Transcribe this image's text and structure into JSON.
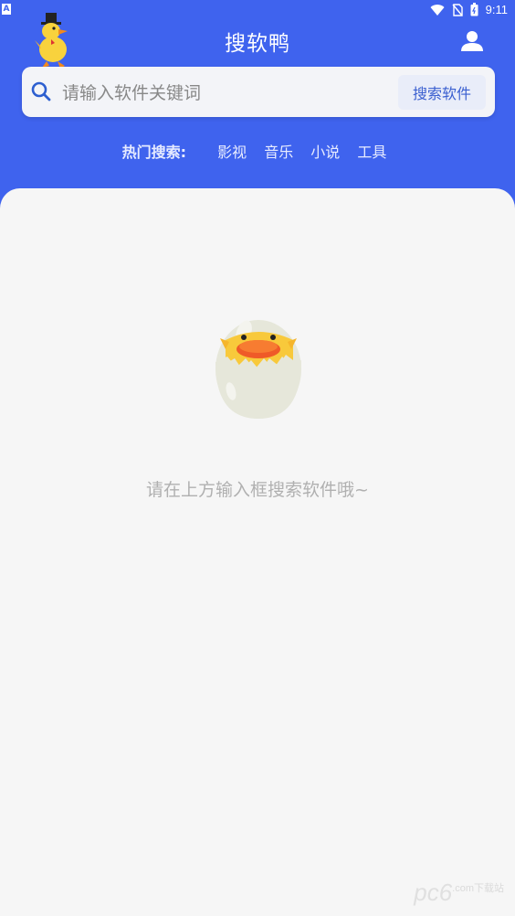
{
  "status_bar": {
    "notification": "A",
    "time": "9:11"
  },
  "header": {
    "title": "搜软鸭"
  },
  "search": {
    "placeholder": "请输入软件关键词",
    "value": "",
    "button_label": "搜索软件"
  },
  "hot_search": {
    "label": "热门搜索:",
    "tags": [
      "影视",
      "音乐",
      "小说",
      "工具"
    ]
  },
  "empty_state": {
    "message": "请在上方输入框搜索软件哦~"
  },
  "watermark": {
    "text": "pc6",
    "suffix": ".com",
    "sub": "下载站"
  },
  "colors": {
    "primary": "#3f63ee",
    "background": "#f6f6f6",
    "button_text": "#3a5fd0"
  }
}
